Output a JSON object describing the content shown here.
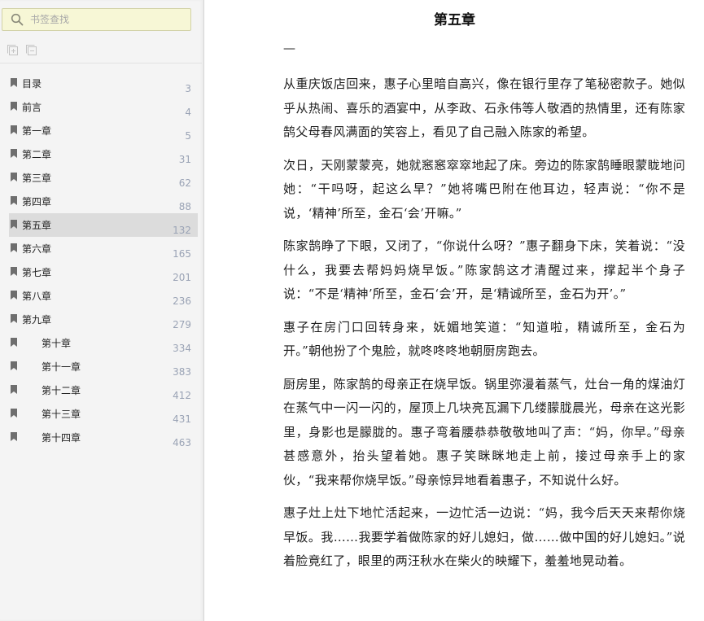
{
  "sidebar": {
    "search_placeholder": "书签查找",
    "toc": [
      {
        "label": "目录",
        "page": "3"
      },
      {
        "label": "前言",
        "page": "4"
      },
      {
        "label": "第一章",
        "page": "5"
      },
      {
        "label": "第二章",
        "page": "31"
      },
      {
        "label": "第三章",
        "page": "62"
      },
      {
        "label": "第四章",
        "page": "88"
      },
      {
        "label": "第五章",
        "page": "132",
        "active": true
      },
      {
        "label": "第六章",
        "page": "165"
      },
      {
        "label": "第七章",
        "page": "201"
      },
      {
        "label": "第八章",
        "page": "236"
      },
      {
        "label": "第九章",
        "page": "279"
      },
      {
        "label": "第十章",
        "page": "334",
        "sub": true
      },
      {
        "label": "第十一章",
        "page": "383",
        "sub": true
      },
      {
        "label": "第十二章",
        "page": "412",
        "sub": true
      },
      {
        "label": "第十三章",
        "page": "431",
        "sub": true
      },
      {
        "label": "第十四章",
        "page": "463",
        "sub": true
      }
    ]
  },
  "document": {
    "chapter_title": "第五章",
    "dash": "—",
    "paragraphs": [
      "从重庆饭店回来，惠子心里暗自高兴，像在银行里存了笔秘密款子。她似乎从热闹、喜乐的酒宴中，从李政、石永伟等人敬酒的热情里，还有陈家鹄父母春风满面的笑容上，看见了自己融入陈家的希望。",
      "次日，天刚蒙蒙亮，她就窸窸窣窣地起了床。旁边的陈家鹄睡眼蒙眬地问她：“干吗呀，起这么早？”她将嘴巴附在他耳边，轻声说：“你不是说，‘精神’所至，金石‘会’开嘛。”",
      "陈家鹄睁了下眼，又闭了，“你说什么呀？”惠子翻身下床，笑着说：“没什么，我要去帮妈妈烧早饭。”陈家鹄这才清醒过来，撑起半个身子说：“不是‘精神’所至，金石‘会’开，是‘精诚所至，金石为开’。”",
      "惠子在房门口回转身来，妩媚地笑道：“知道啦，精诚所至，金石为开。”朝他扮了个鬼脸，就咚咚咚地朝厨房跑去。",
      "厨房里，陈家鹄的母亲正在烧早饭。锅里弥漫着蒸气，灶台一角的煤油灯在蒸气中一闪一闪的，屋顶上几块亮瓦漏下几缕朦胧晨光，母亲在这光影里，身影也是朦胧的。惠子弯着腰恭恭敬敬地叫了声：“妈，你早。”母亲甚感意外，抬头望着她。惠子笑眯眯地走上前，接过母亲手上的家伙，“我来帮你烧早饭。”母亲惊异地看着惠子，不知说什么好。",
      "惠子灶上灶下地忙活起来，一边忙活一边说：“妈，我今后天天来帮你烧早饭。我……我要学着做陈家的好儿媳妇，做……做中国的好儿媳妇。”说着脸竟红了，眼里的两汪秋水在柴火的映耀下，羞羞地晃动着。"
    ]
  }
}
